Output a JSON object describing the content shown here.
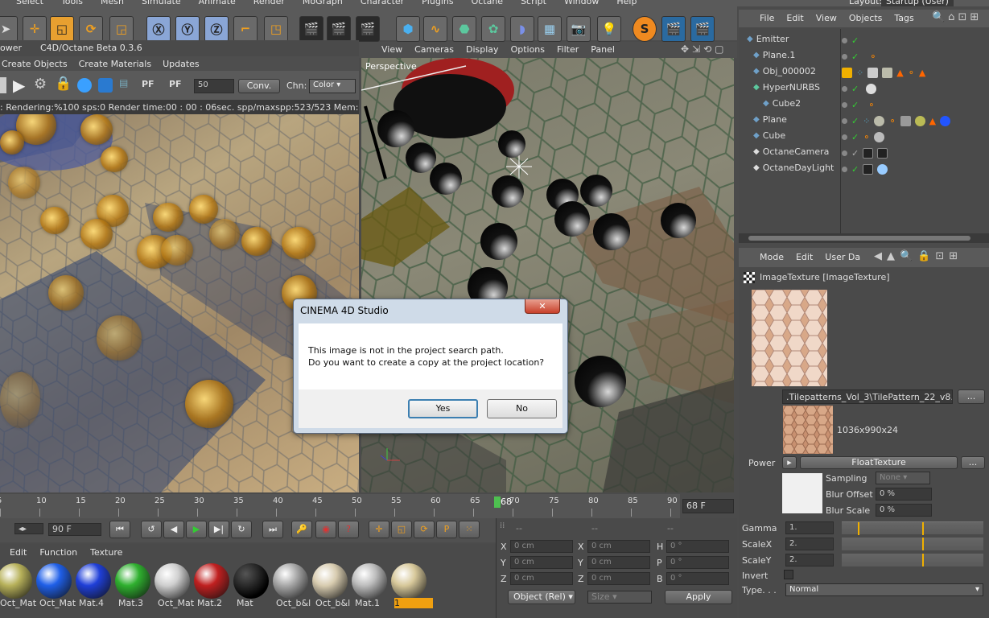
{
  "menubar": {
    "items": [
      "Select",
      "Tools",
      "Mesh",
      "Simulate",
      "Animate",
      "Render",
      "MoGraph",
      "Character",
      "Plugins",
      "Octane",
      "Script",
      "Window",
      "Help"
    ],
    "layout_label": "Layout:",
    "layout_value": "Startup (User)"
  },
  "octane_panel": {
    "tab_power": "ower",
    "title": "C4D/Octane Beta 0.3.6",
    "menu": [
      "Create Objects",
      "Create Materials",
      "Updates"
    ],
    "samples_value": "50",
    "conv_label": "Conv.",
    "chn_label": "Chn:",
    "chn_value": "Color",
    "status": ": Rendering:%100 sps:0 Render time:00 : 00 : 06sec. spp/maxspp:523/523 Mem:13/1320/"
  },
  "viewport": {
    "menu": [
      "View",
      "Cameras",
      "Display",
      "Options",
      "Filter",
      "Panel"
    ],
    "label": "Perspective"
  },
  "object_manager": {
    "menu": [
      "File",
      "Edit",
      "View",
      "Objects",
      "Tags"
    ],
    "objects": [
      {
        "name": "Emitter",
        "color": "#6fa0c8"
      },
      {
        "name": "Plane.1",
        "color": "#6fa0c8"
      },
      {
        "name": "Obj_000002",
        "color": "#6fa0c8"
      },
      {
        "name": "HyperNURBS",
        "color": "#5cc89e"
      },
      {
        "name": "Cube2",
        "color": "#6fa0c8"
      },
      {
        "name": "Plane",
        "color": "#6fa0c8"
      },
      {
        "name": "Cube",
        "color": "#6fa0c8"
      },
      {
        "name": "OctaneCamera",
        "color": "#dddddd"
      },
      {
        "name": "OctaneDayLight",
        "color": "#dddddd"
      }
    ]
  },
  "attribute_manager": {
    "menu": [
      "Mode",
      "Edit",
      "User Da"
    ],
    "title": "ImageTexture [ImageTexture]",
    "file_path": ".Tilepatterns_Vol_3\\TilePattern_22_v8.jpg",
    "dims": "1036x990x24",
    "power_label": "Power",
    "power_value": "FloatTexture",
    "sampling_label": "Sampling",
    "sampling_value": "None",
    "blur_offset_label": "Blur Offset",
    "blur_offset_value": "0 %",
    "blur_scale_label": "Blur Scale",
    "blur_scale_value": "0 %",
    "gamma_label": "Gamma",
    "gamma_value": "1.",
    "scalex_label": "ScaleX",
    "scalex_value": "2.",
    "scaley_label": "ScaleY",
    "scaley_value": "2.",
    "invert_label": "Invert",
    "type_label": "Type. . .",
    "type_value": "Normal",
    "ellipsis": "..."
  },
  "timeline": {
    "ticks": [
      "5",
      "10",
      "15",
      "20",
      "25",
      "30",
      "35",
      "40",
      "45",
      "50",
      "55",
      "60",
      "65",
      "70",
      "75",
      "80",
      "85",
      "90"
    ],
    "current_frame": "68",
    "current_field": "68 F",
    "end_field": "90 F"
  },
  "material_manager": {
    "menu": [
      "Edit",
      "Function",
      "Texture"
    ],
    "materials": [
      {
        "name": "Oct_Mat",
        "color": "#b7b15a"
      },
      {
        "name": "Oct_Mat",
        "color": "#1f5fe8"
      },
      {
        "name": "Mat.4",
        "color": "#1f3fd8"
      },
      {
        "name": "Mat.3",
        "color": "#2fb02f"
      },
      {
        "name": "Oct_Mat",
        "color": "#cfcfcf"
      },
      {
        "name": "Mat.2",
        "color": "#c02020"
      },
      {
        "name": "Mat",
        "color": "#111111"
      },
      {
        "name": "Oct_b&l",
        "color": "#a9a9a9"
      },
      {
        "name": "Oct_b&l",
        "color": "#d8ccb0"
      },
      {
        "name": "Mat.1",
        "color": "#bdbdbd"
      },
      {
        "name": "1",
        "color": "#d7c89a"
      }
    ]
  },
  "coordinates": {
    "header": [
      "--",
      "--",
      "--"
    ],
    "rows": [
      {
        "a": "X",
        "av": "0 cm",
        "b": "X",
        "bv": "0 cm",
        "c": "H",
        "cv": "0 °"
      },
      {
        "a": "Y",
        "av": "0 cm",
        "b": "Y",
        "bv": "0 cm",
        "c": "P",
        "cv": "0 °"
      },
      {
        "a": "Z",
        "av": "0 cm",
        "b": "Z",
        "bv": "0 cm",
        "c": "B",
        "cv": "0 °"
      }
    ],
    "mode": "Object (Rel)",
    "size": "Size",
    "apply": "Apply"
  },
  "dialog": {
    "title": "CINEMA 4D Studio",
    "line1": "This image is not in the project search path.",
    "line2": "Do you want to create a copy at the project location?",
    "yes": "Yes",
    "no": "No",
    "close": "✕"
  }
}
